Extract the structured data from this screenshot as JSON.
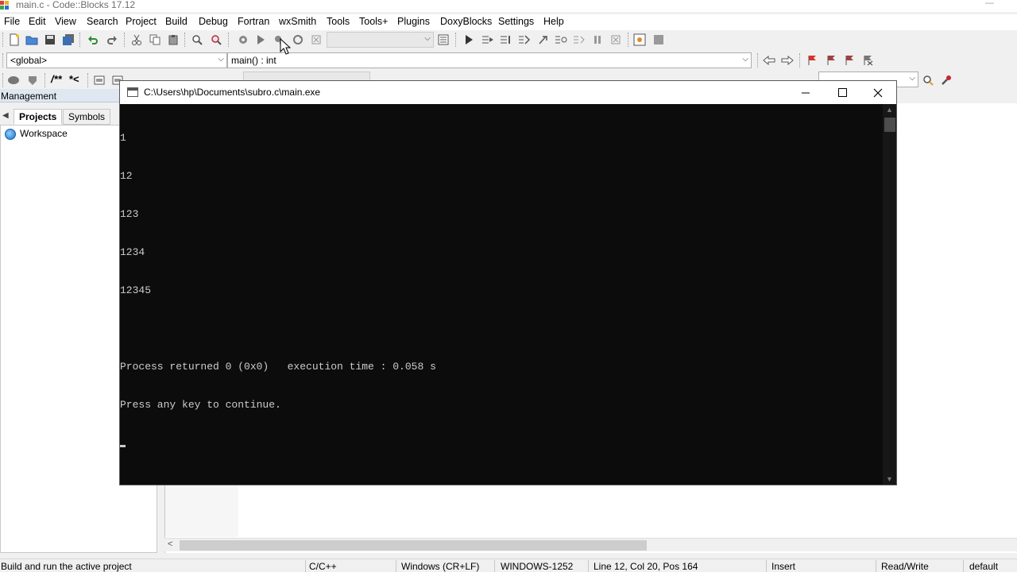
{
  "app": {
    "title": "main.c - Code::Blocks 17.12"
  },
  "menu": [
    "File",
    "Edit",
    "View",
    "Search",
    "Project",
    "Build",
    "Debug",
    "Fortran",
    "wxSmith",
    "Tools",
    "Tools+",
    "Plugins",
    "DoxyBlocks",
    "Settings",
    "Help"
  ],
  "toolbar2": {
    "scope": "<global>",
    "function": "main() : int"
  },
  "doxy": {
    "block_comment": "/**",
    "line_comment": "*<"
  },
  "management": {
    "title": "Management",
    "tabs": [
      "Projects",
      "Symbols"
    ],
    "workspace": "Workspace"
  },
  "console": {
    "title": "C:\\Users\\hp\\Documents\\subro.c\\main.exe",
    "lines": [
      "1",
      "12",
      "123",
      "1234",
      "12345",
      "",
      "Process returned 0 (0x0)   execution time : 0.058 s",
      "Press any key to continue."
    ]
  },
  "status": {
    "hint": "Build and run the active project",
    "language": "C/C++",
    "line_endings": "Windows (CR+LF)",
    "encoding": "WINDOWS-1252",
    "position": "Line 12, Col 20, Pos 164",
    "mode": "Insert",
    "access": "Read/Write",
    "profile": "default"
  }
}
